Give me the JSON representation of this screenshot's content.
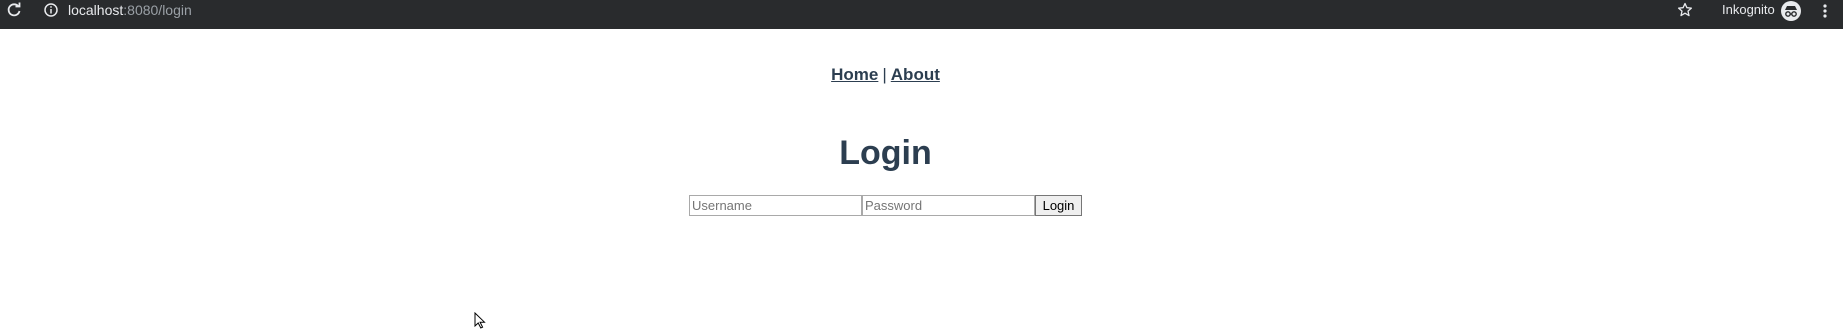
{
  "browser": {
    "url_host": "localhost",
    "url_rest": ":8080/login",
    "incognito_label": "Inkognito"
  },
  "nav": {
    "home_label": "Home",
    "separator": "|",
    "about_label": "About"
  },
  "page": {
    "title": "Login"
  },
  "login_form": {
    "username": {
      "value": "",
      "placeholder": "Username"
    },
    "password": {
      "value": "",
      "placeholder": "Password"
    },
    "submit_label": "Login"
  }
}
